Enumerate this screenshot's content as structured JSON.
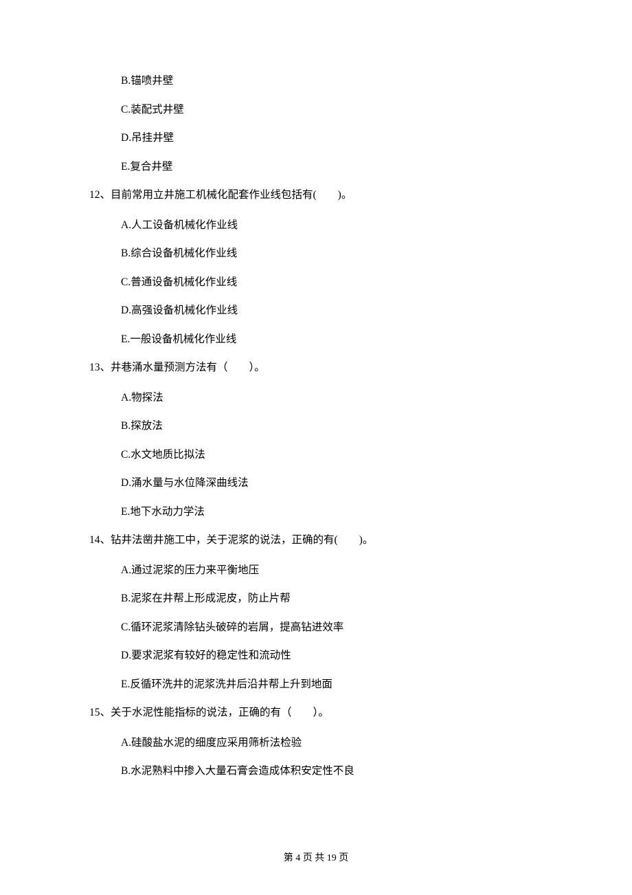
{
  "q11": {
    "options": {
      "B": "B.锚喷井壁",
      "C": "C.装配式井壁",
      "D": "D.吊挂井壁",
      "E": "E.复合井壁"
    }
  },
  "q12": {
    "stem": "12、目前常用立井施工机械化配套作业线包括有(　　)。",
    "options": {
      "A": "A.人工设备机械化作业线",
      "B": "B.综合设备机械化作业线",
      "C": "C.普通设备机械化作业线",
      "D": "D.高强设备机械化作业线",
      "E": "E.一般设备机械化作业线"
    }
  },
  "q13": {
    "stem": "13、井巷涌水量预测方法有（　　）。",
    "options": {
      "A": "A.物探法",
      "B": "B.探放法",
      "C": "C.水文地质比拟法",
      "D": "D.涌水量与水位降深曲线法",
      "E": "E.地下水动力学法"
    }
  },
  "q14": {
    "stem": "14、钻井法凿井施工中，关于泥浆的说法，正确的有(　　)。",
    "options": {
      "A": "A.通过泥浆的压力来平衡地压",
      "B": "B.泥浆在井帮上形成泥皮，防止片帮",
      "C": "C.循环泥浆清除钻头破碎的岩屑，提高钻进效率",
      "D": "D.要求泥浆有较好的稳定性和流动性",
      "E": "E.反循环洗井的泥浆洗井后沿井帮上升到地面"
    }
  },
  "q15": {
    "stem": "15、关于水泥性能指标的说法，正确的有（　　）。",
    "options": {
      "A": "A.硅酸盐水泥的细度应采用筛析法检验",
      "B": "B.水泥熟料中掺入大量石膏会造成体积安定性不良"
    }
  },
  "footer": "第 4 页 共 19 页"
}
